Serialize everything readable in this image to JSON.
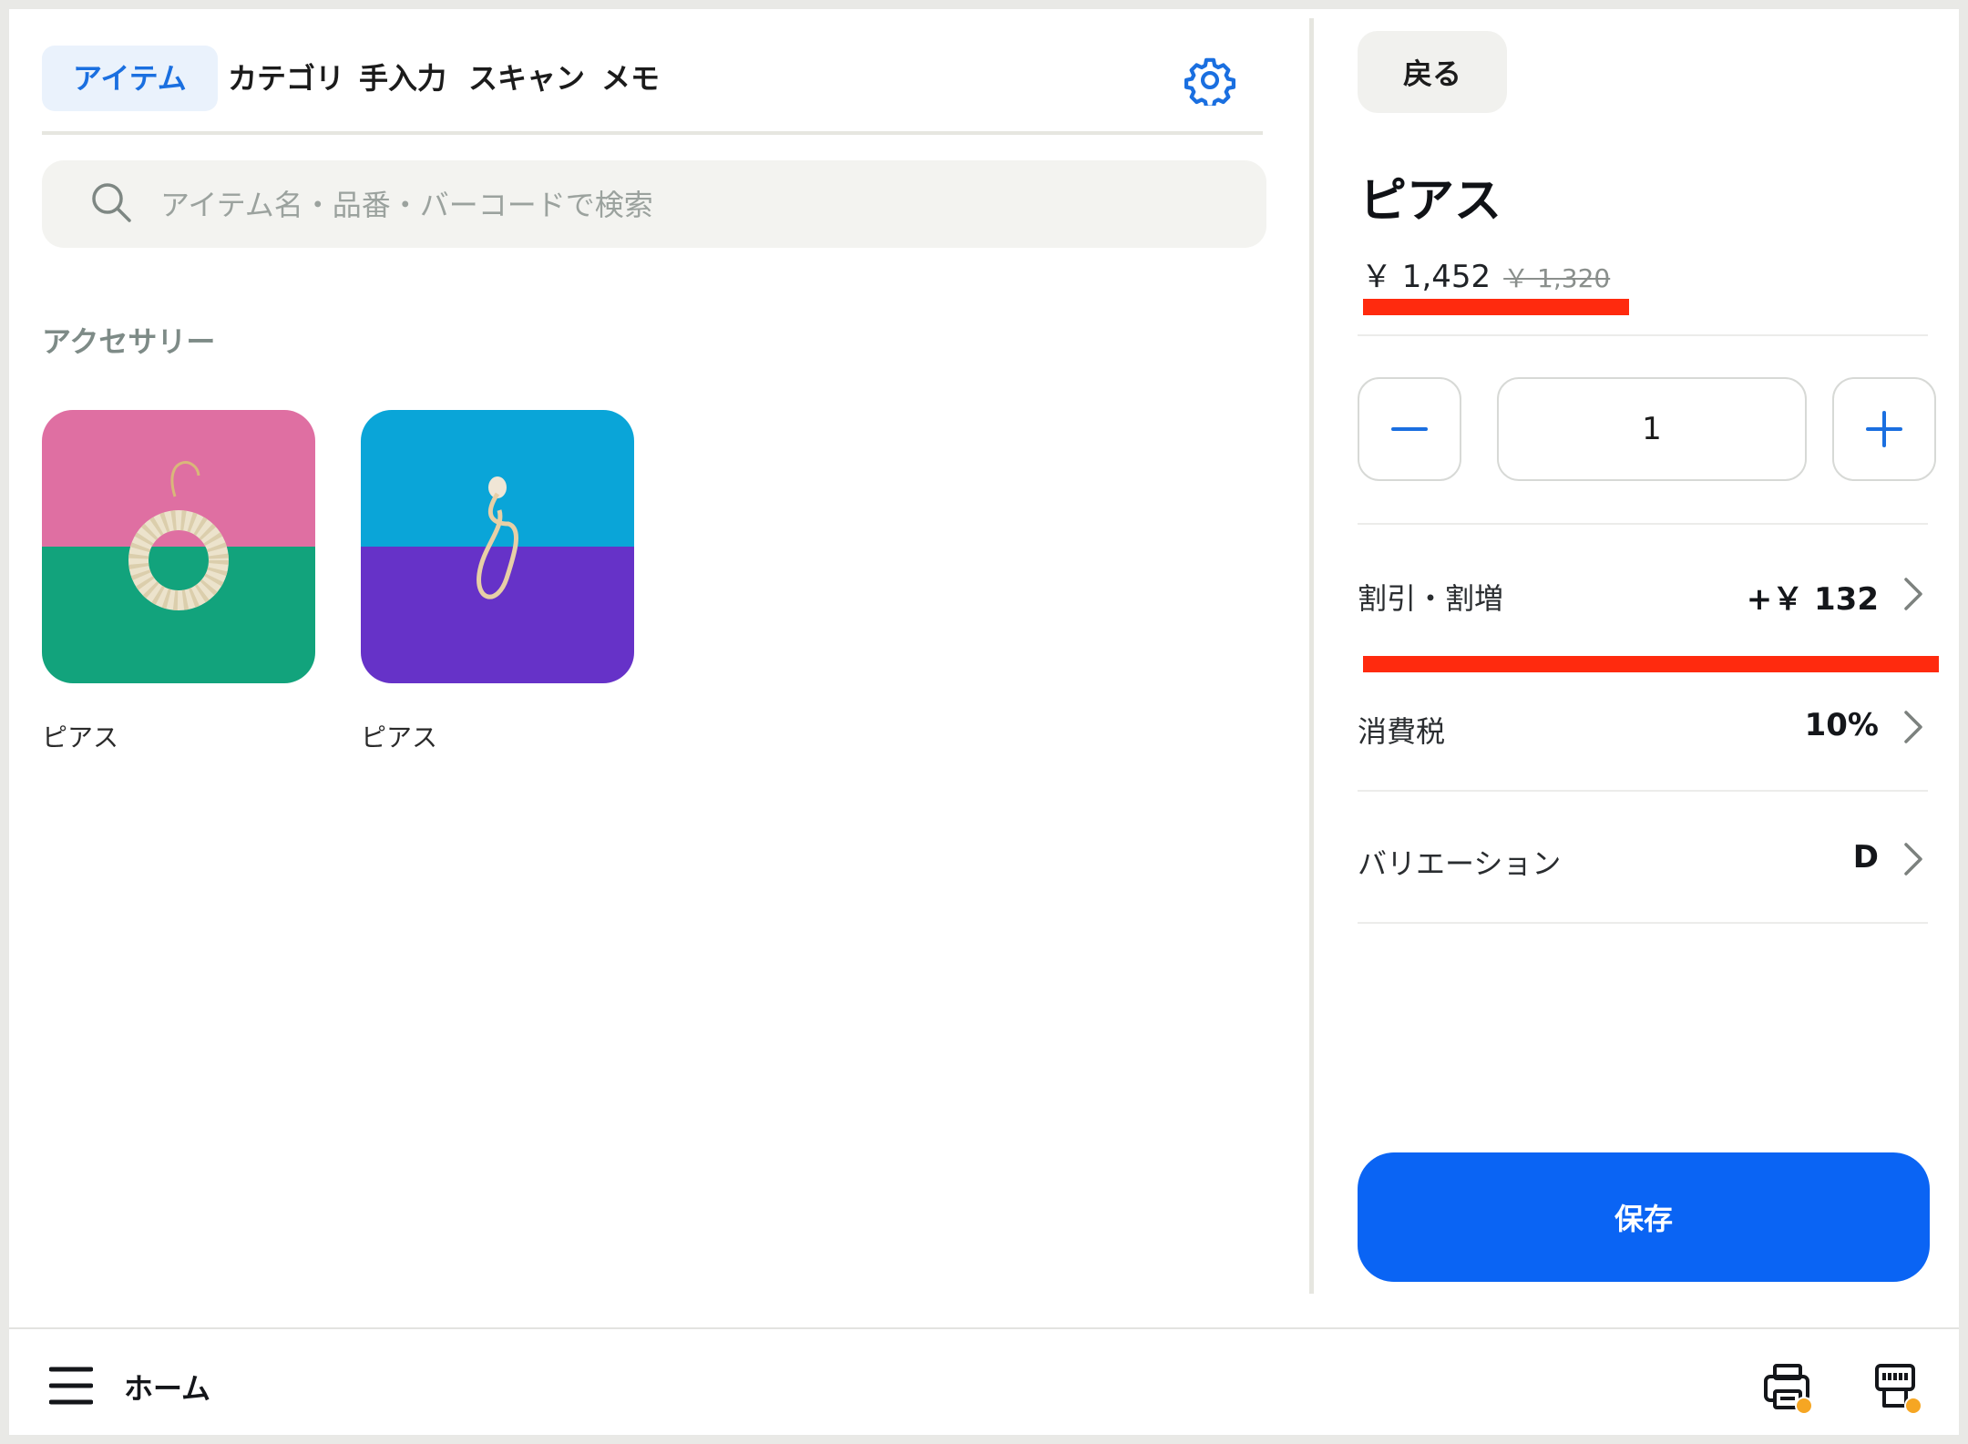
{
  "tabs": [
    {
      "label": "アイテム",
      "active": true
    },
    {
      "label": "カテゴリ",
      "active": false
    },
    {
      "label": "手入力",
      "active": false
    },
    {
      "label": "スキャン",
      "active": false
    },
    {
      "label": "メモ",
      "active": false
    }
  ],
  "settings_icon": "gear-icon",
  "search": {
    "placeholder": "アイテム名・品番・バーコードで検索",
    "value": "",
    "icon": "search-icon"
  },
  "section": {
    "title": "アクセサリー"
  },
  "items": [
    {
      "name": "ピアス",
      "colors": {
        "top": "#df6fa2",
        "bottom": "#12a37c"
      }
    },
    {
      "name": "ピアス",
      "colors": {
        "top": "#0aa5d8",
        "bottom": "#6632c8"
      }
    }
  ],
  "detail": {
    "back_label": "戻る",
    "title": "ピアス",
    "price": "￥ 1,452",
    "original_price": "￥ 1,320",
    "quantity": "1",
    "rows": [
      {
        "label": "割引・割増",
        "value": "+￥ 132"
      },
      {
        "label": "消費税",
        "value": "10%"
      },
      {
        "label": "バリエーション",
        "value": "D"
      }
    ],
    "save_label": "保存"
  },
  "bottom": {
    "home_label": "ホーム",
    "icons": [
      "printer-icon",
      "receipt-printer-icon"
    ],
    "status_dot_color": "#f6a623"
  },
  "colors": {
    "accent": "#0a64f4",
    "highlight": "#ff2a0e",
    "tab_active_bg": "#eaf2fc"
  }
}
